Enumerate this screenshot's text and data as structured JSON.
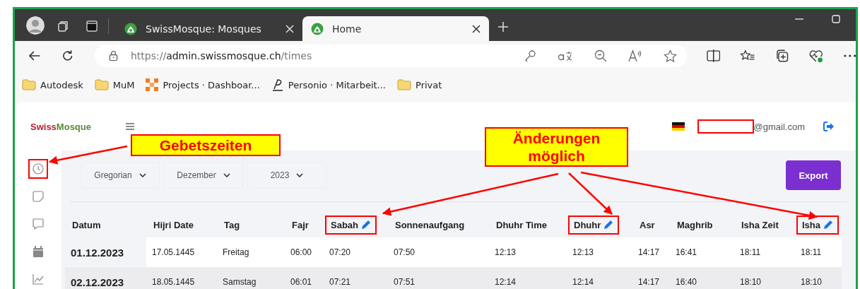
{
  "browser": {
    "tabs": [
      {
        "title": "SwissMosque: Mosques",
        "selected": false
      },
      {
        "title": "Home",
        "selected": true
      }
    ],
    "address": {
      "scheme": "https://",
      "host": "admin.swissmosque.ch",
      "path": "/times"
    },
    "bookmarks": [
      {
        "label": "Autodesk",
        "kind": "folder"
      },
      {
        "label": "MuM",
        "kind": "folder"
      },
      {
        "label": "Projects · Dashboar...",
        "kind": "grid"
      },
      {
        "label": "Personio · Mitarbeit...",
        "kind": "signature"
      },
      {
        "label": "Privat",
        "kind": "folder"
      }
    ]
  },
  "app": {
    "logo": {
      "first": "Swiss",
      "second": "Mosque"
    },
    "user_email": "@gmail.com",
    "sidebar": [
      {
        "kind": "clock",
        "highlighted": true
      },
      {
        "kind": "note",
        "highlighted": false
      },
      {
        "kind": "chat",
        "highlighted": false
      },
      {
        "kind": "calendar",
        "highlighted": false
      },
      {
        "kind": "chart",
        "highlighted": false
      }
    ],
    "filters": [
      "Gregorian",
      "Dezember",
      "2023"
    ],
    "export_label": "Export",
    "table": {
      "columns": [
        {
          "label": "Datum",
          "editable": false,
          "highlighted": false
        },
        {
          "label": "Hijri Date",
          "editable": false,
          "highlighted": false
        },
        {
          "label": "Tag",
          "editable": false,
          "highlighted": false
        },
        {
          "label": "Fajr",
          "editable": false,
          "highlighted": false
        },
        {
          "label": "Sabah",
          "editable": true,
          "highlighted": true
        },
        {
          "label": "Sonnenaufgang",
          "editable": false,
          "highlighted": false
        },
        {
          "label": "Dhuhr Time",
          "editable": false,
          "highlighted": false
        },
        {
          "label": "Dhuhr",
          "editable": true,
          "highlighted": true
        },
        {
          "label": "Asr",
          "editable": false,
          "highlighted": false
        },
        {
          "label": "Maghrib",
          "editable": false,
          "highlighted": false
        },
        {
          "label": "Isha Zeit",
          "editable": false,
          "highlighted": false
        },
        {
          "label": "Isha",
          "editable": true,
          "highlighted": true
        }
      ],
      "rows": [
        [
          "01.12.2023",
          "17.05.1445",
          "Freitag",
          "06:00",
          "07:20",
          "07:50",
          "12:13",
          "12:13",
          "14:17",
          "16:41",
          "18:11",
          "18:11"
        ],
        [
          "02.12.2023",
          "18.05.1445",
          "Samstag",
          "06:01",
          "07:21",
          "07:51",
          "12:14",
          "12:14",
          "14:17",
          "16:40",
          "18:10",
          "18:10"
        ]
      ]
    }
  },
  "annotations": [
    {
      "text": "Gebetszeiten"
    },
    {
      "text": "Änderungen möglich"
    }
  ]
}
